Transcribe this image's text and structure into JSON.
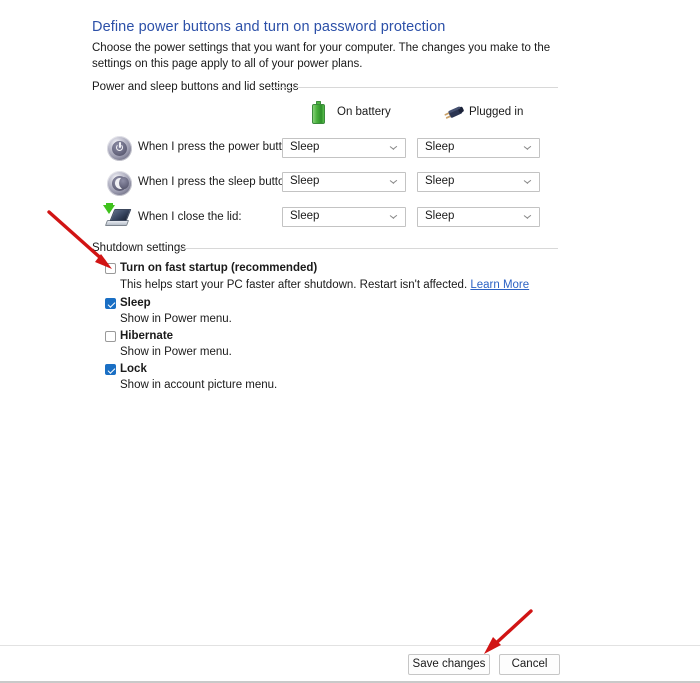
{
  "page": {
    "title": "Define power buttons and turn on password protection",
    "subtitle": "Choose the power settings that you want for your computer. The changes you make to the settings on this page apply to all of your power plans."
  },
  "sections": {
    "power_sleep_lid": {
      "heading": "Power and sleep buttons and lid settings",
      "columns": [
        {
          "label": "On battery",
          "icon": "battery-icon"
        },
        {
          "label": "Plugged in",
          "icon": "power-plug-icon"
        }
      ],
      "rows": [
        {
          "icon": "power-button-icon",
          "label": "When I press the power button:",
          "on_battery": "Sleep",
          "plugged_in": "Sleep"
        },
        {
          "icon": "sleep-button-icon",
          "label": "When I press the sleep button:",
          "on_battery": "Sleep",
          "plugged_in": "Sleep"
        },
        {
          "icon": "laptop-lid-icon",
          "label": "When I close the lid:",
          "on_battery": "Sleep",
          "plugged_in": "Sleep"
        }
      ]
    },
    "shutdown": {
      "heading": "Shutdown settings",
      "items": [
        {
          "label": "Turn on fast startup (recommended)",
          "checked": false,
          "description": "This helps start your PC faster after shutdown. Restart isn't affected.",
          "link": "Learn More"
        },
        {
          "label": "Sleep",
          "checked": true,
          "description": "Show in Power menu."
        },
        {
          "label": "Hibernate",
          "checked": false,
          "description": "Show in Power menu."
        },
        {
          "label": "Lock",
          "checked": true,
          "description": "Show in account picture menu."
        }
      ]
    }
  },
  "footer": {
    "save_label": "Save changes",
    "cancel_label": "Cancel"
  },
  "colors": {
    "title": "#2c50a8",
    "link": "#2c62c4",
    "checkbox_checked": "#1a6fc4",
    "annotation_arrow": "#d11414",
    "battery": "#49b03c"
  },
  "annotations": [
    {
      "name": "arrow-to-fast-startup-checkbox",
      "color": "#d11414"
    },
    {
      "name": "arrow-to-save-changes-button",
      "color": "#d11414"
    }
  ]
}
